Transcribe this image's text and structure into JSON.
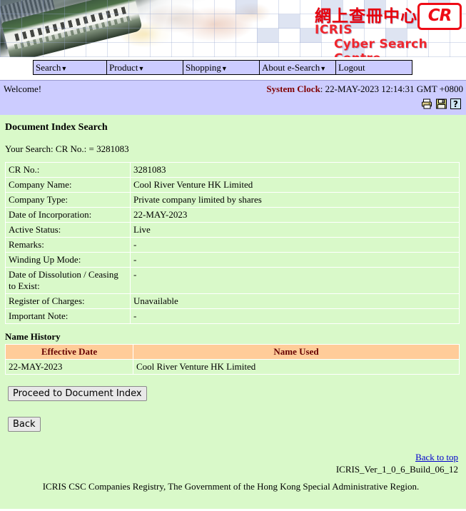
{
  "banner": {
    "logo_chinese": "網上查冊中心",
    "logo_icris": "ICRIS",
    "logo_csc": "Cyber Search Centre",
    "logo_cr": "CR"
  },
  "nav": {
    "items": [
      {
        "label": "Search",
        "caret": "▼"
      },
      {
        "label": "Product",
        "caret": "▼"
      },
      {
        "label": "Shopping",
        "caret": "▼"
      },
      {
        "label": "About e-Search",
        "caret": "▼"
      },
      {
        "label": "Logout",
        "caret": ""
      }
    ]
  },
  "statusbar": {
    "welcome": "Welcome!",
    "clock_label": "System Clock",
    "clock_sep": ": ",
    "clock_value": "22-MAY-2023 12:14:31 GMT +0800",
    "icons": [
      "printer-icon",
      "save-icon",
      "help-icon"
    ]
  },
  "main": {
    "page_title": "Document Index Search",
    "your_search": "Your Search: CR No.: = 3281083",
    "details": [
      {
        "label": "CR No.:",
        "value": "3281083"
      },
      {
        "label": "Company Name:",
        "value": "Cool River Venture HK Limited"
      },
      {
        "label": "Company Type:",
        "value": "Private company limited by shares"
      },
      {
        "label": "Date of Incorporation:",
        "value": "22-MAY-2023"
      },
      {
        "label": "Active Status:",
        "value": "Live"
      },
      {
        "label": "Remarks:",
        "value": "-"
      },
      {
        "label": "Winding Up Mode:",
        "value": "-"
      },
      {
        "label": "Date of Dissolution / Ceasing to Exist:",
        "value": "-"
      },
      {
        "label": "Register of Charges:",
        "value": "Unavailable"
      },
      {
        "label": "Important Note:",
        "value": "-"
      }
    ],
    "name_history": {
      "title": "Name History",
      "columns": [
        "Effective Date",
        "Name Used"
      ],
      "rows": [
        {
          "effective_date": "22-MAY-2023",
          "name_used": "Cool River Venture HK Limited"
        }
      ]
    },
    "buttons": {
      "proceed": "Proceed to Document Index",
      "back": "Back"
    }
  },
  "footer": {
    "back_to_top": "Back to top",
    "version": "ICRIS_Ver_1_0_6_Build_06_12",
    "copyright": "ICRIS CSC Companies Registry, The Government of the Hong Kong Special Administrative Region."
  },
  "colors": {
    "nav_bg": "#ccccff",
    "content_bg": "#d9f9c9",
    "table_header_bg": "#ffcc99",
    "accent_red": "#ee0b16",
    "link_blue": "#0000cc",
    "clock_label": "#800000"
  }
}
